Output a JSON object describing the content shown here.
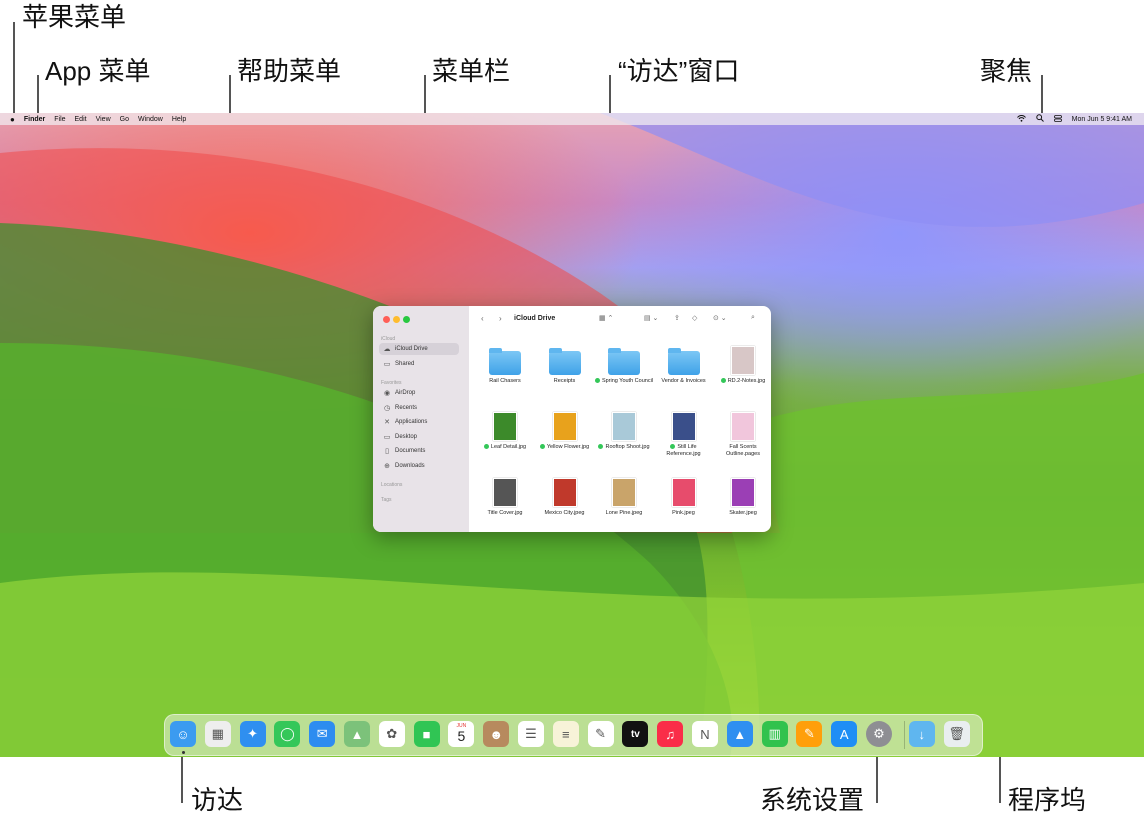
{
  "callouts": {
    "apple_menu": "苹果菜单",
    "app_menu": "App 菜单",
    "help_menu": "帮助菜单",
    "menu_bar": "菜单栏",
    "finder_window": "“访达”窗口",
    "spotlight": "聚焦",
    "finder": "访达",
    "system_settings": "系统设置",
    "dock": "程序坞"
  },
  "menubar": {
    "apple_icon": "",
    "items": [
      "Finder",
      "File",
      "Edit",
      "View",
      "Go",
      "Window",
      "Help"
    ],
    "status": {
      "wifi": "wifi-icon",
      "spotlight": "search-icon",
      "control_center": "control-center-icon",
      "datetime": "Mon Jun 5  9:41 AM"
    }
  },
  "finder": {
    "title": "iCloud Drive",
    "sidebar": {
      "sections": [
        {
          "heading": "iCloud",
          "items": [
            {
              "label": "iCloud Drive",
              "icon": "☁",
              "selected": true
            },
            {
              "label": "Shared",
              "icon": "▭"
            }
          ]
        },
        {
          "heading": "Favorites",
          "items": [
            {
              "label": "AirDrop",
              "icon": "◉"
            },
            {
              "label": "Recents",
              "icon": "◷"
            },
            {
              "label": "Applications",
              "icon": "✕"
            },
            {
              "label": "Desktop",
              "icon": "▭"
            },
            {
              "label": "Documents",
              "icon": "▯"
            },
            {
              "label": "Downloads",
              "icon": "⊕"
            }
          ]
        },
        {
          "heading": "Locations",
          "items": []
        },
        {
          "heading": "Tags",
          "items": []
        }
      ]
    },
    "files": [
      {
        "name": "Rail Chasers",
        "kind": "folder",
        "tag": false
      },
      {
        "name": "Receipts",
        "kind": "folder",
        "tag": false
      },
      {
        "name": "Spring Youth Council",
        "kind": "folder",
        "tag": true
      },
      {
        "name": "Vendor & Invoices",
        "kind": "folder",
        "tag": false
      },
      {
        "name": "RD.2-Notes.jpg",
        "kind": "photo",
        "tag": true,
        "color": "#d8c7c7"
      },
      {
        "name": "Leaf Detail.jpg",
        "kind": "photo",
        "tag": true,
        "color": "#3c8a2a"
      },
      {
        "name": "Yellow Flower.jpg",
        "kind": "photo",
        "tag": true,
        "color": "#e8a21c"
      },
      {
        "name": "Rooftop Shoot.jpg",
        "kind": "photo",
        "tag": true,
        "color": "#a9c9d8"
      },
      {
        "name": "Still Life Reference.jpg",
        "kind": "photo",
        "tag": true,
        "color": "#3a4f8a"
      },
      {
        "name": "Fall Scents Outline.pages",
        "kind": "photo",
        "tag": false,
        "color": "#f1c6dc"
      },
      {
        "name": "Title Cover.jpg",
        "kind": "photo",
        "tag": false,
        "color": "#555555"
      },
      {
        "name": "Mexico City.jpeg",
        "kind": "photo",
        "tag": false,
        "color": "#c0392b"
      },
      {
        "name": "Lone Pine.jpeg",
        "kind": "photo",
        "tag": false,
        "color": "#c9a46a"
      },
      {
        "name": "Pink.jpeg",
        "kind": "photo",
        "tag": false,
        "color": "#e74c6c"
      },
      {
        "name": "Skater.jpeg",
        "kind": "photo",
        "tag": false,
        "color": "#9b3fb5"
      }
    ]
  },
  "dock": {
    "calendar_month": "JUN",
    "calendar_day": "5",
    "tv_label": "tv",
    "apps": [
      {
        "name": "finder-icon",
        "color": "#3b9bf0",
        "glyph": "☺",
        "running": true
      },
      {
        "name": "launchpad-icon",
        "color": "#eeeeee",
        "glyph": "▦"
      },
      {
        "name": "safari-icon",
        "color": "#2f8ff0",
        "glyph": "✦"
      },
      {
        "name": "messages-icon",
        "color": "#34c759",
        "glyph": "◯"
      },
      {
        "name": "mail-icon",
        "color": "#2d8cf0",
        "glyph": "✉"
      },
      {
        "name": "maps-icon",
        "color": "#7cc27a",
        "glyph": "▲"
      },
      {
        "name": "photos-icon",
        "color": "#ffffff",
        "glyph": "✿"
      },
      {
        "name": "facetime-icon",
        "color": "#30c554",
        "glyph": "■"
      },
      {
        "name": "calendar-icon",
        "color": "#ffffff",
        "glyph": ""
      },
      {
        "name": "contacts-icon",
        "color": "#b78a5e",
        "glyph": "☻"
      },
      {
        "name": "reminders-icon",
        "color": "#ffffff",
        "glyph": "☰"
      },
      {
        "name": "notes-icon",
        "color": "#f7f3d8",
        "glyph": "≡"
      },
      {
        "name": "freeform-icon",
        "color": "#ffffff",
        "glyph": "✎"
      },
      {
        "name": "tv-icon",
        "color": "#111111",
        "glyph": ""
      },
      {
        "name": "music-icon",
        "color": "#fa2d48",
        "glyph": "♫"
      },
      {
        "name": "news-icon",
        "color": "#ffffff",
        "glyph": "N"
      },
      {
        "name": "keynote-icon",
        "color": "#2f8ff0",
        "glyph": "▲"
      },
      {
        "name": "numbers-icon",
        "color": "#31c24d",
        "glyph": "▥"
      },
      {
        "name": "pages-icon",
        "color": "#ff9f0a",
        "glyph": "✎"
      },
      {
        "name": "app-store-icon",
        "color": "#1e8ef5",
        "glyph": "A"
      },
      {
        "name": "system-settings-icon",
        "color": "#8e8e93",
        "glyph": "⚙"
      },
      {
        "name": "downloads-folder-icon",
        "color": "#5fb6ef",
        "glyph": "↓"
      },
      {
        "name": "trash-icon",
        "color": "#e9eef0",
        "glyph": "🗑"
      }
    ]
  }
}
